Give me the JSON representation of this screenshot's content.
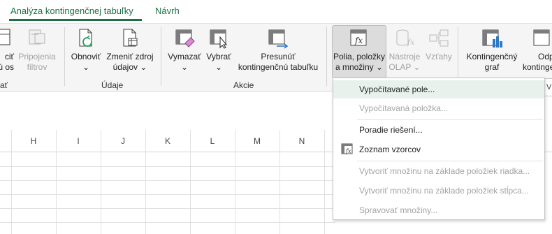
{
  "tabs": {
    "analyze": "Analýza kontingenčnej tabuľky",
    "design": "Návrh"
  },
  "ribbon": {
    "left_partial": {
      "line1": "ciť",
      "line2": "ú os",
      "group": "ať"
    },
    "connections": {
      "line1": "Pripojenia",
      "line2": "filtrov"
    },
    "refresh": {
      "line1": "Obnoviť",
      "arrow": "⌄"
    },
    "change_source": {
      "line1": "Zmeniť zdroj",
      "line2": "údajov ⌄"
    },
    "group_data": "Údaje",
    "clear": {
      "line1": "Vymazať",
      "arrow": "⌄"
    },
    "select": {
      "line1": "Vybrať",
      "arrow": "⌄"
    },
    "move": {
      "line1": "Presunúť",
      "line2": "kontingenčnú tabuľku"
    },
    "group_actions": "Akcie",
    "fields": {
      "line1": "Polia, položky",
      "line2": "a množiny ⌄"
    },
    "olap": {
      "line1": "Nástroje",
      "line2": "OLAP ⌄"
    },
    "relations": {
      "line1": "Vzťahy"
    },
    "pivot_chart": {
      "line1": "Kontingenčný",
      "line2": "graf"
    },
    "recommended_partial": {
      "line1": "Odp",
      "line2": "kontinge"
    }
  },
  "namebox_fragment": "V",
  "columns": [
    "H",
    "I",
    "J",
    "K",
    "L",
    "M",
    "N"
  ],
  "menu": {
    "items": [
      {
        "label": "Vypočítavané pole...",
        "enabled": true,
        "highlighted": true
      },
      {
        "label": "Vypočítavaná položka...",
        "enabled": false
      },
      {
        "label": "Poradie riešení...",
        "enabled": true
      },
      {
        "label": "Zoznam vzorcov",
        "enabled": true
      },
      {
        "label": "Vytvoriť množinu na základe položiek riadka...",
        "enabled": false
      },
      {
        "label": "Vytvoriť množinu na základe položiek stĺpca...",
        "enabled": false
      },
      {
        "label": "Spravovať množiny...",
        "enabled": false
      }
    ]
  },
  "colors": {
    "accent": "#1e7145",
    "ribbon_bg": "#f5f5f5",
    "disabled_text": "#a3a3a3",
    "menu_highlight": "#e8f1ec"
  }
}
